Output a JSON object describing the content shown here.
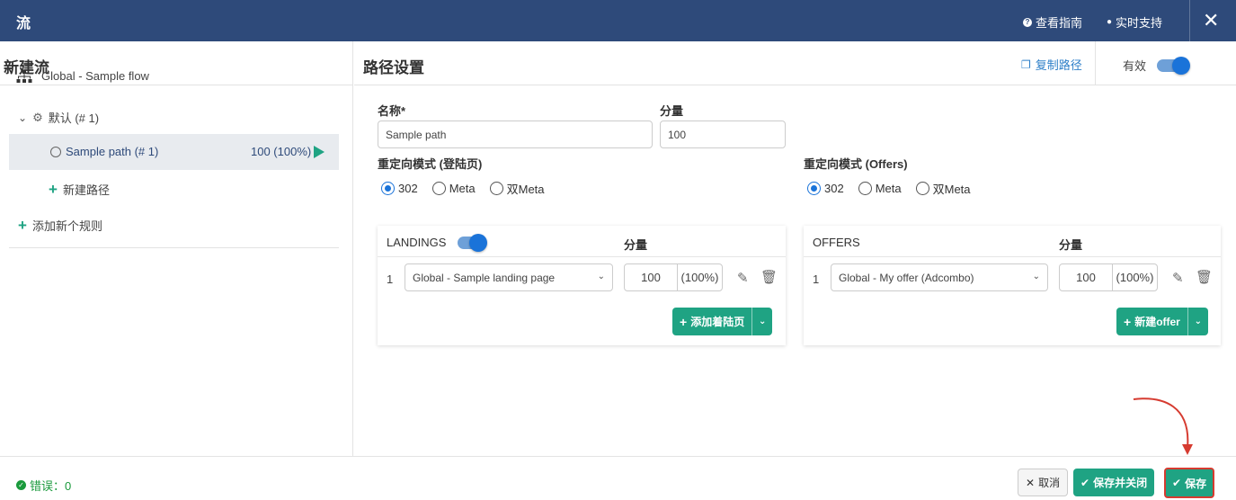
{
  "header": {
    "title": "流",
    "guide_link": "查看指南",
    "support_link": "实时支持"
  },
  "left": {
    "title": "新建流",
    "flow_name": "Global - Sample flow",
    "rule_label": "默认 (# 1)",
    "path_label": "Sample path (# 1)",
    "path_share": "100 (100%)",
    "new_path": "新建路径",
    "add_rule": "添加新个规则"
  },
  "right": {
    "title": "路径设置",
    "copy_path": "复制路径",
    "active_label": "有效",
    "active_on": true,
    "name_label": "名称*",
    "name_value": "Sample path",
    "share_label": "分量",
    "share_value": "100",
    "redirect_landing_label": "重定向模式 (登陆页)",
    "redirect_offers_label": "重定向模式 (Offers)",
    "redirect_options": [
      "302",
      "Meta",
      "双Meta"
    ],
    "redirect_landing_selected": "302",
    "redirect_offers_selected": "302",
    "landings": {
      "title": "LANDINGS",
      "share_label": "分量",
      "index": "1",
      "selected": "Global - Sample landing page",
      "share": "100",
      "percent": "(100%)",
      "add_button": "添加着陆页"
    },
    "offers": {
      "title": "OFFERS",
      "share_label": "分量",
      "index": "1",
      "selected": "Global - My offer (Adcombo)",
      "share": "100",
      "percent": "(100%)",
      "add_button": "新建offer"
    }
  },
  "footer": {
    "errors": "错误：0",
    "cancel": "取消",
    "save_close": "保存并关闭",
    "save": "保存"
  },
  "colors": {
    "header_bg": "#2e4a7a",
    "accent_green": "#1fa383",
    "accent_blue": "#1a73d9",
    "highlight_red": "#d63b30"
  }
}
